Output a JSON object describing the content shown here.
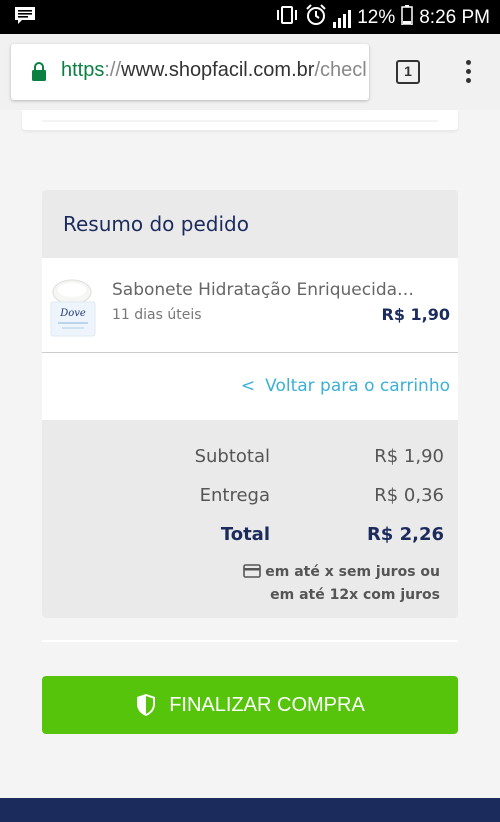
{
  "status_bar": {
    "battery": "12%",
    "time": "8:26 PM"
  },
  "browser": {
    "url_scheme": "https",
    "url_sep": "://",
    "url_host": "www.shopfacil.com.br",
    "url_path": "/checl",
    "tab_count": "1"
  },
  "order_summary": {
    "title": "Resumo do pedido",
    "product": {
      "name": "Sabonete Hidratação Enriquecida…",
      "shipping": "11 dias úteis",
      "price": "R$ 1,90",
      "brand": "Dove"
    },
    "back_link": "Voltar para o carrinho",
    "back_chevron": "<"
  },
  "totals": {
    "subtotal_label": "Subtotal",
    "subtotal_value": "R$ 1,90",
    "delivery_label": "Entrega",
    "delivery_value": "R$ 0,36",
    "total_label": "Total",
    "total_value": "R$ 2,26",
    "installments_line1": "em até x sem juros ou",
    "installments_line2": "em até 12x com juros"
  },
  "finalize_button": {
    "label": "FINALIZAR COMPRA"
  },
  "colors": {
    "brand_navy": "#1b2b5c",
    "accent_green": "#55c40a",
    "link_blue": "#3bb0d8"
  }
}
